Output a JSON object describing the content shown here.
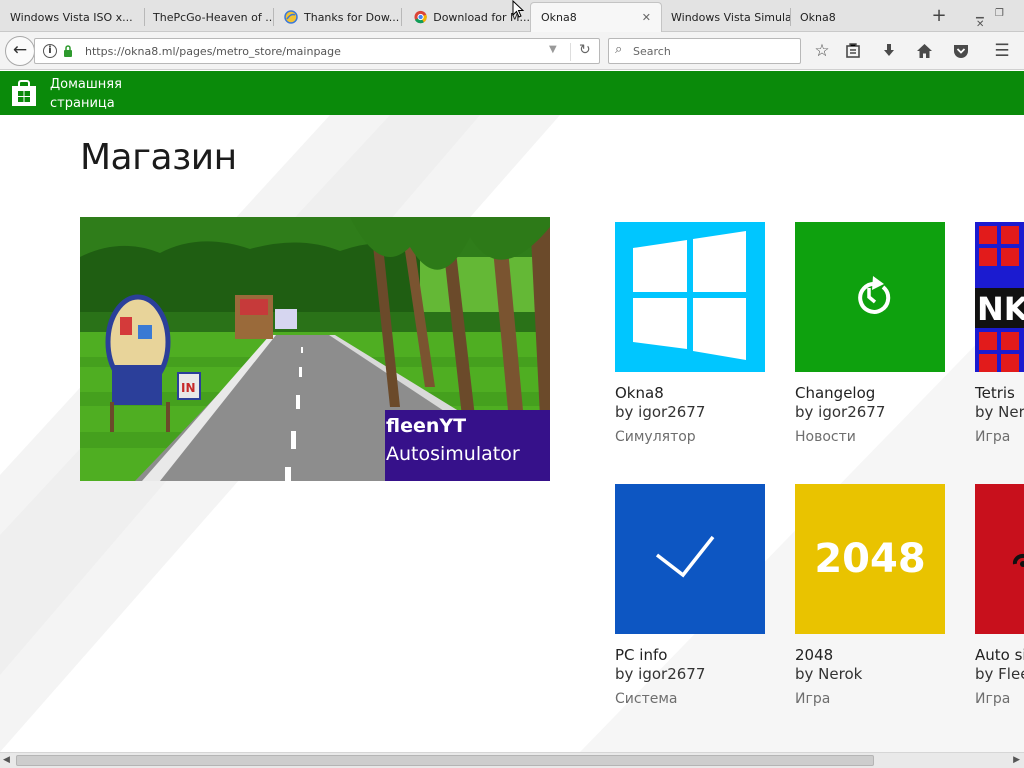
{
  "browser": {
    "tabs": [
      {
        "title": "Windows Vista ISO x...",
        "icon": "page-icon"
      },
      {
        "title": "ThePcGo-Heaven of ...",
        "icon": "page-icon"
      },
      {
        "title": "Thanks for Dow...",
        "icon": "globe-icon"
      },
      {
        "title": "Download for M...",
        "icon": "chrome-icon"
      },
      {
        "title": "Okna8",
        "icon": "page-icon",
        "active": true,
        "close": "✕"
      },
      {
        "title": "Windows Vista Simula...",
        "icon": "page-icon"
      },
      {
        "title": "Okna8",
        "icon": "page-icon"
      }
    ],
    "new_tab": "+",
    "window_controls": "▁ ❐ ✕",
    "url": "https://okna8.ml/pages/metro_store/mainpage",
    "search_placeholder": "Search"
  },
  "header": {
    "home_label_1": "Домашняя",
    "home_label_2": "страница",
    "accent_color": "#0a8a0a"
  },
  "store": {
    "title": "Магазин",
    "featured": {
      "title": "fleenYT",
      "subtitle": "Autosimulator",
      "sign_text": "IN"
    },
    "apps": [
      {
        "name": "Okna8",
        "author": "by igor2677",
        "category": "Симулятор",
        "color": "#00c6ff",
        "icon": "windows-logo-icon"
      },
      {
        "name": "Changelog",
        "author": "by igor2677",
        "category": "Новости",
        "color": "#0ea10e",
        "icon": "history-icon"
      },
      {
        "name": "Tetris",
        "author": "by Nero",
        "category": "Игра",
        "color": "#1b1bd0",
        "icon": "tetris-icon",
        "tile_text": "NK"
      },
      {
        "name": "PC info",
        "author": "by igor2677",
        "category": "Система",
        "color": "#0d56c2",
        "icon": "checkmark-icon"
      },
      {
        "name": "2048",
        "author": "by Nerok",
        "category": "Игра",
        "color": "#e9c300",
        "icon": "2048-icon",
        "tile_text": "2048"
      },
      {
        "name": "Auto si",
        "author": "by Flee",
        "category": "Игра",
        "color": "#c8101c",
        "icon": "car-icon"
      }
    ]
  }
}
